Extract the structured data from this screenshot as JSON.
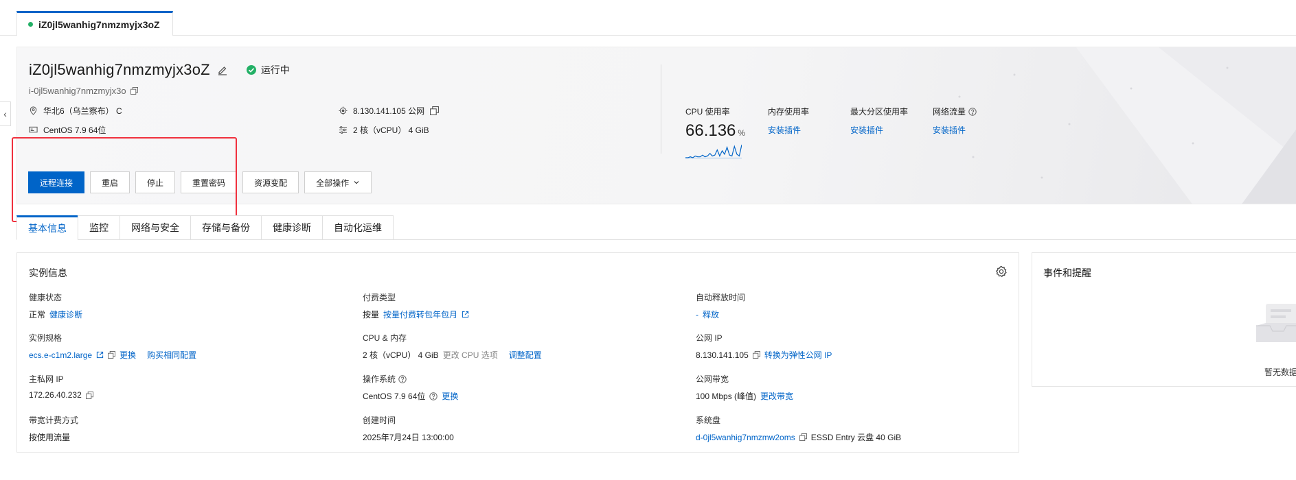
{
  "top_tab": {
    "label": "iZ0jl5wanhig7nmzmyjx3oZ"
  },
  "header": {
    "title": "iZ0jl5wanhig7nmzmyjx3oZ",
    "status": "运行中",
    "instance_id": "i-0jl5wanhig7nmzmyjx3o",
    "region": "华北6（乌兰察布） C",
    "public_ip": "8.130.141.105 公网",
    "os": "CentOS 7.9 64位",
    "spec": "2 核（vCPU） 4 GiB"
  },
  "actions": [
    {
      "label": "远程连接"
    },
    {
      "label": "重启"
    },
    {
      "label": "停止"
    },
    {
      "label": "重置密码"
    },
    {
      "label": "资源变配"
    },
    {
      "label": "全部操作"
    }
  ],
  "metrics": {
    "cpu_label": "CPU 使用率",
    "cpu_value": "66.136",
    "cpu_unit": "%",
    "cpu_spark": [
      0,
      0,
      1,
      0,
      2,
      1,
      1,
      3,
      1,
      2,
      5,
      2,
      3,
      9,
      2,
      8,
      4,
      12,
      3,
      2,
      13,
      4,
      2,
      15
    ],
    "mem_label": "内存使用率",
    "mem_link": "安装插件",
    "disk_label": "最大分区使用率",
    "disk_link": "安装插件",
    "net_label": "网络流量",
    "net_link": "安装插件"
  },
  "tabs": [
    {
      "label": "基本信息"
    },
    {
      "label": "监控"
    },
    {
      "label": "网络与安全"
    },
    {
      "label": "存储与备份"
    },
    {
      "label": "健康诊断"
    },
    {
      "label": "自动化运维"
    }
  ],
  "instance_info": {
    "title": "实例信息",
    "health_label": "健康状态",
    "health_value": "正常",
    "health_link": "健康诊断",
    "billing_label": "付费类型",
    "billing_value": "按量",
    "billing_link": "按量付费转包年包月",
    "release_label": "自动释放时间",
    "release_value": "-",
    "release_link": "释放",
    "spec_label": "实例规格",
    "spec_value": "ecs.e-c1m2.large",
    "spec_link_change": "更换",
    "spec_link_buy": "购买相同配置",
    "cpu_mem_label": "CPU & 内存",
    "cpu_mem_value": "2 核（vCPU） 4 GiB",
    "cpu_mem_muted": "更改 CPU 选项",
    "cpu_mem_link": "调整配置",
    "public_ip_label": "公网 IP",
    "public_ip_value": "8.130.141.105",
    "public_ip_link": "转换为弹性公网 IP",
    "private_ip_label": "主私网 IP",
    "private_ip_value": "172.26.40.232",
    "os_label": "操作系统",
    "os_value": "CentOS 7.9 64位",
    "os_link": "更换",
    "bandwidth_label": "公网带宽",
    "bandwidth_value": "100 Mbps (峰值)",
    "bandwidth_link": "更改带宽",
    "bw_billing_label": "带宽计费方式",
    "bw_billing_value": "按使用流量",
    "created_label": "创建时间",
    "created_value": "2025年7月24日 13:00:00",
    "system_disk_label": "系统盘",
    "system_disk_link": "d-0jl5wanhig7nmzmw2oms",
    "system_disk_value": "ESSD Entry 云盘  40 GiB"
  },
  "events": {
    "title": "事件和提醒",
    "empty": "暂无数据"
  },
  "colors": {
    "primary": "#0064c8",
    "success": "#23b066",
    "annotation": "#f0303d"
  }
}
